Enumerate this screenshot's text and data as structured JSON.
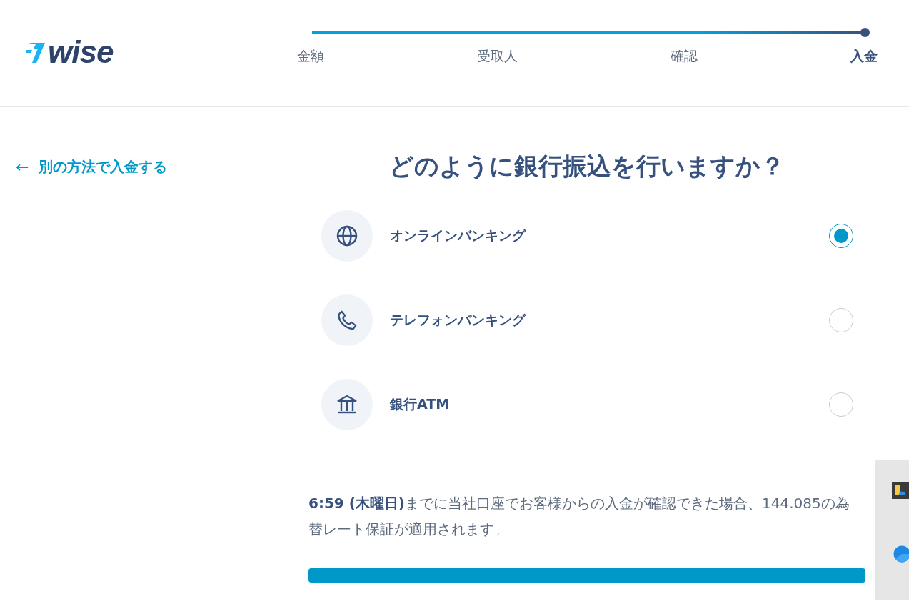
{
  "logo": {
    "text": "wise"
  },
  "steps": {
    "progress": {
      "level": 1
    },
    "items": [
      {
        "label": "金額",
        "selected": false
      },
      {
        "label": "受取人",
        "selected": false
      },
      {
        "label": "確認",
        "selected": false
      },
      {
        "label": "入金",
        "selected": true
      }
    ]
  },
  "back_link": {
    "icon": "←",
    "label": "別の方法で入金する"
  },
  "heading": "どのように銀行振込を行いますか？",
  "options": [
    {
      "kind": "globe",
      "label": "オンラインバンキング",
      "selected": true
    },
    {
      "kind": "phone",
      "label": "テレフォンバンキング",
      "selected": false
    },
    {
      "kind": "bank",
      "label": "銀行ATM",
      "selected": false
    }
  ],
  "notice": "**6:59 (木曜日)**までに当社口座でお客様からの入金が確認できた場合、144.085の為替レート保証が適用されます。"
}
